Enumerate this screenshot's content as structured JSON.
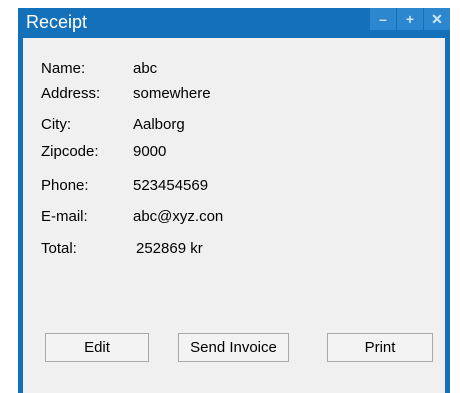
{
  "window": {
    "title": "Receipt",
    "controls": {
      "minimize": "–",
      "maximize": "+",
      "close": "✕"
    }
  },
  "fields": [
    {
      "label": "Name:",
      "value": "abc"
    },
    {
      "label": "Address:",
      "value": "somewhere"
    },
    {
      "label": "City:",
      "value": "Aalborg"
    },
    {
      "label": "Zipcode:",
      "value": "9000"
    },
    {
      "label": "Phone:",
      "value": "523454569"
    },
    {
      "label": "E-mail:",
      "value": "abc@xyz.con"
    },
    {
      "label": "Total:",
      "value": "252869 kr"
    }
  ],
  "buttons": {
    "edit": "Edit",
    "send_invoice": "Send Invoice",
    "print": "Print"
  },
  "colors": {
    "titlebar": "#1470b8",
    "content_bg": "#f0f0f0"
  }
}
